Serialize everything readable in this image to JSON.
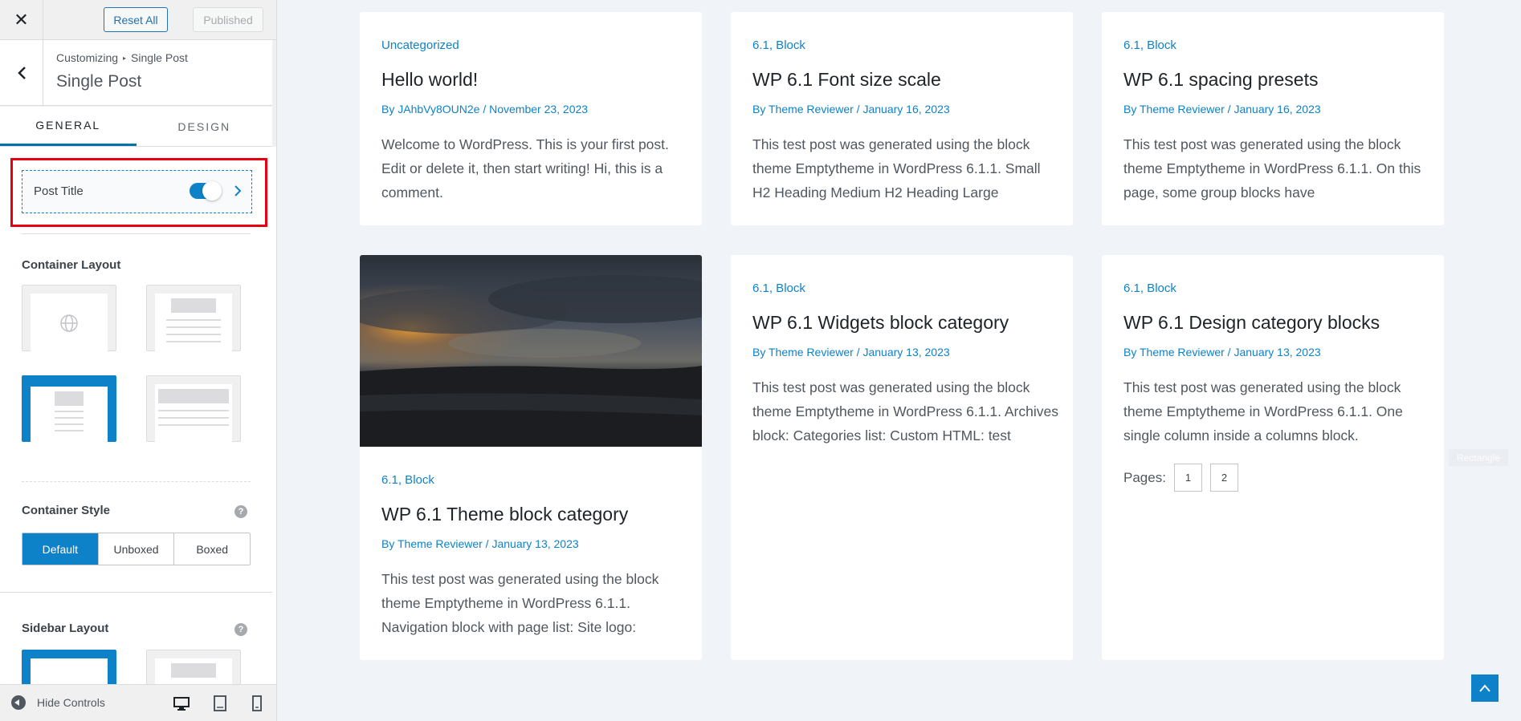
{
  "header": {
    "close_icon": "close-icon",
    "reset_label": "Reset All",
    "publish_label": "Published"
  },
  "panel": {
    "breadcrumb_root": "Customizing",
    "breadcrumb_current": "Single Post",
    "title": "Single Post"
  },
  "tabs": [
    {
      "label": "GENERAL",
      "active": true
    },
    {
      "label": "DESIGN",
      "active": false
    }
  ],
  "post_title": {
    "label": "Post Title",
    "enabled": true
  },
  "container_layout": {
    "label": "Container Layout",
    "selected_index": 2
  },
  "container_style": {
    "label": "Container Style",
    "options": [
      "Default",
      "Unboxed",
      "Boxed"
    ],
    "selected": "Default"
  },
  "sidebar_layout": {
    "label": "Sidebar Layout",
    "selected_index": 0
  },
  "footer": {
    "hide_controls": "Hide Controls",
    "devices": [
      "desktop-icon",
      "tablet-icon",
      "mobile-icon"
    ]
  },
  "posts": [
    {
      "categories": "Uncategorized",
      "title": "Hello world!",
      "meta": "By JAhbVy8OUN2e / November 23, 2023",
      "excerpt": "Welcome to WordPress. This is your first post. Edit or delete it, then start writing! Hi, this is a comment."
    },
    {
      "categories": "6.1, Block",
      "title": "WP 6.1 Font size scale",
      "meta": "By Theme Reviewer / January 16, 2023",
      "excerpt": "This test post was generated using the block theme Emptytheme in WordPress 6.1.1. Small H2 Heading Medium H2 Heading Large"
    },
    {
      "categories": "6.1, Block",
      "title": "WP 6.1 spacing presets",
      "meta": "By Theme Reviewer / January 16, 2023",
      "excerpt": "This test post was generated using the block theme Emptytheme in WordPress 6.1.1. On this page, some group blocks have"
    },
    {
      "categories": "6.1, Block",
      "title": "WP 6.1 Theme block category",
      "meta": "By Theme Reviewer / January 13, 2023",
      "excerpt": "This test post was generated using the block theme Emptytheme in WordPress 6.1.1. Navigation block with page list: Site logo:"
    },
    {
      "categories": "6.1, Block",
      "title": "WP 6.1 Widgets block category",
      "meta": "By Theme Reviewer / January 13, 2023",
      "excerpt": "This test post was generated using the block theme Emptytheme in WordPress 6.1.1. Archives block: Categories list: Custom HTML: test"
    },
    {
      "categories": "6.1, Block",
      "title": "WP 6.1 Design category blocks",
      "meta": "By Theme Reviewer / January 13, 2023",
      "excerpt": "This test post was generated using the block theme Emptytheme in WordPress 6.1.1. One single column inside a columns block."
    }
  ],
  "pagination": {
    "label": "Pages:",
    "pages": [
      "1",
      "2"
    ]
  },
  "overlay_label": "Rectangle",
  "colors": {
    "accent": "#0e82c8",
    "highlight": "#e60012",
    "background": "#f0f3f8"
  }
}
